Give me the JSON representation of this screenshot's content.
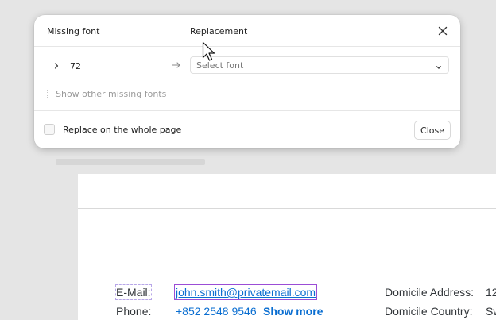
{
  "dialog": {
    "header_missing": "Missing font",
    "header_replacement": "Replacement",
    "font_name": "72",
    "select_placeholder": "Select font",
    "show_other": "Show other missing fonts",
    "checkbox_label": "Replace on the whole page",
    "close_label": "Close",
    "checkbox_checked": false
  },
  "document": {
    "email_label": "E-Mail:",
    "email_value": "john.smith@privatemail.com",
    "phone_label": "Phone:",
    "phone_value": "+852 2548 9546",
    "show_more": "Show more",
    "address_label": "Domicile Address:",
    "address_value_partial": "12",
    "country_label": "Domicile Country:",
    "country_value_partial": "Sw"
  },
  "icons": {
    "close": "close-icon",
    "expand": "chevron-right-icon",
    "arrow": "arrow-right-icon",
    "dropdown": "chevron-down-icon",
    "pointer": "mouse-pointer-icon"
  },
  "colors": {
    "link": "#0a6ed1",
    "selection_outline": "#9b4dd6",
    "dialog_bg": "#ffffff",
    "canvas_bg": "#e5e5e5"
  }
}
